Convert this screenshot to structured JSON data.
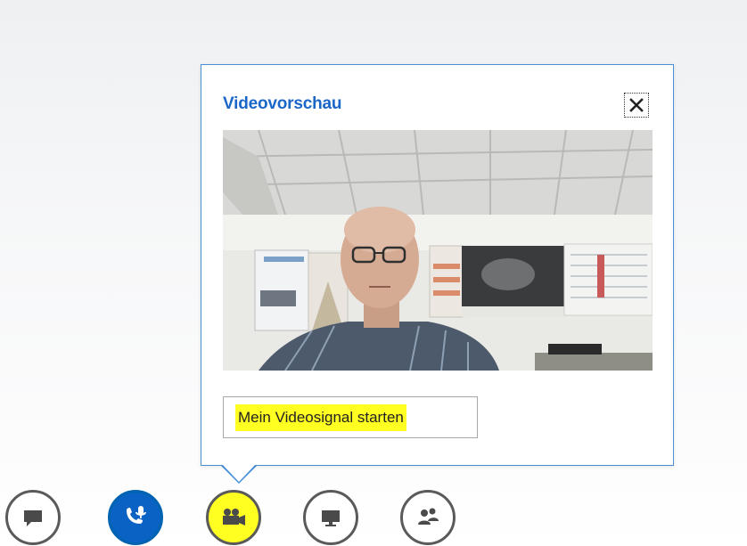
{
  "popup": {
    "title": "Videovorschau",
    "close_icon": "close-icon",
    "preview_description_icon": "camera-preview-image",
    "start_button_label": "Mein Videosignal starten",
    "start_button_highlight": "#ffff21"
  },
  "toolbar": {
    "buttons": [
      {
        "icon": "chat-bubble-icon",
        "active": false
      },
      {
        "icon": "phone-microphone-icon",
        "active": true,
        "color": "#0a63c4"
      },
      {
        "icon": "video-camera-icon",
        "active": false,
        "highlight": "#ffff21"
      },
      {
        "icon": "monitor-present-icon",
        "active": false
      },
      {
        "icon": "people-icon",
        "active": false
      }
    ]
  },
  "colors": {
    "accent": "#1b66c9",
    "popup_border": "#4a90d9",
    "toolbar_ring": "#5a5a5a"
  }
}
